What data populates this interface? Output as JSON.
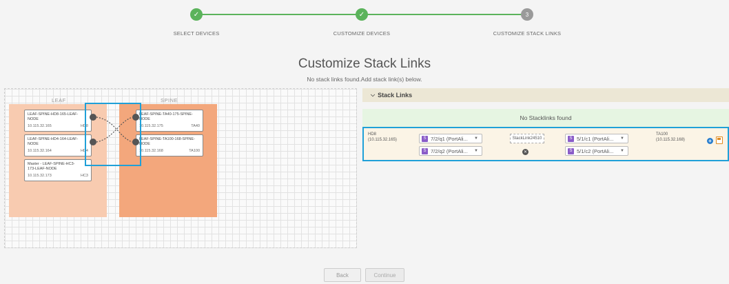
{
  "wizard": {
    "steps": [
      {
        "label": "SELECT DEVICES",
        "mark": "✓"
      },
      {
        "label": "CUSTOMIZE DEVICES",
        "mark": "✓"
      },
      {
        "label": "CUSTOMIZE STACK LINKS",
        "mark": "3"
      }
    ]
  },
  "title": "Customize Stack Links",
  "subtitle": "No stack links found.Add stack link(s) below.",
  "topology": {
    "leaf_label": "LEAF",
    "spine_label": "SPINE",
    "leaf_nodes": [
      {
        "name": "LEAF-SPINE-HD8-165-LEAF-\nNODE",
        "ip": "10.115.32.165",
        "short": "HD8"
      },
      {
        "name": "LEAF-SPINE-HD4-164-LEAF-\nNODE",
        "ip": "10.115.32.164",
        "short": "HD4"
      },
      {
        "name": "Master - LEAF-SPINE-HC3-\n173-LEAF-NODE",
        "ip": "10.115.32.173",
        "short": "HC3"
      }
    ],
    "spine_nodes": [
      {
        "name": "LEAF-SPINE-TA40-175-SPINE-\nNODE",
        "ip": "10.115.32.175",
        "short": "TA40"
      },
      {
        "name": "LEAF-SPINE-TA100-168-SPINE-\nNODE",
        "ip": "10.115.32.168",
        "short": "TA100"
      }
    ]
  },
  "stack_links": {
    "header": "Stack Links",
    "empty_msg": "No Stacklinks found",
    "row": {
      "src_name": "HD8",
      "src_ip": "(10.115.32.165)",
      "src_ports": [
        "7/2/q1 (PortAli...",
        "7/2/q2 (PortAli..."
      ],
      "link_name": "StackLink24510",
      "dst_ports": [
        "5/1/c1 (PortAli...",
        "5/1/c2 (PortAli..."
      ],
      "dst_name": "TA100",
      "dst_ip": "(10.115.32.168)",
      "port_badge": "S"
    }
  },
  "buttons": {
    "back": "Back",
    "continue": "Continue"
  },
  "colors": {
    "accent": "#1fa0d8",
    "done": "#5bb35b",
    "leaf": "#f8cbb0",
    "spine": "#f3a77c"
  }
}
